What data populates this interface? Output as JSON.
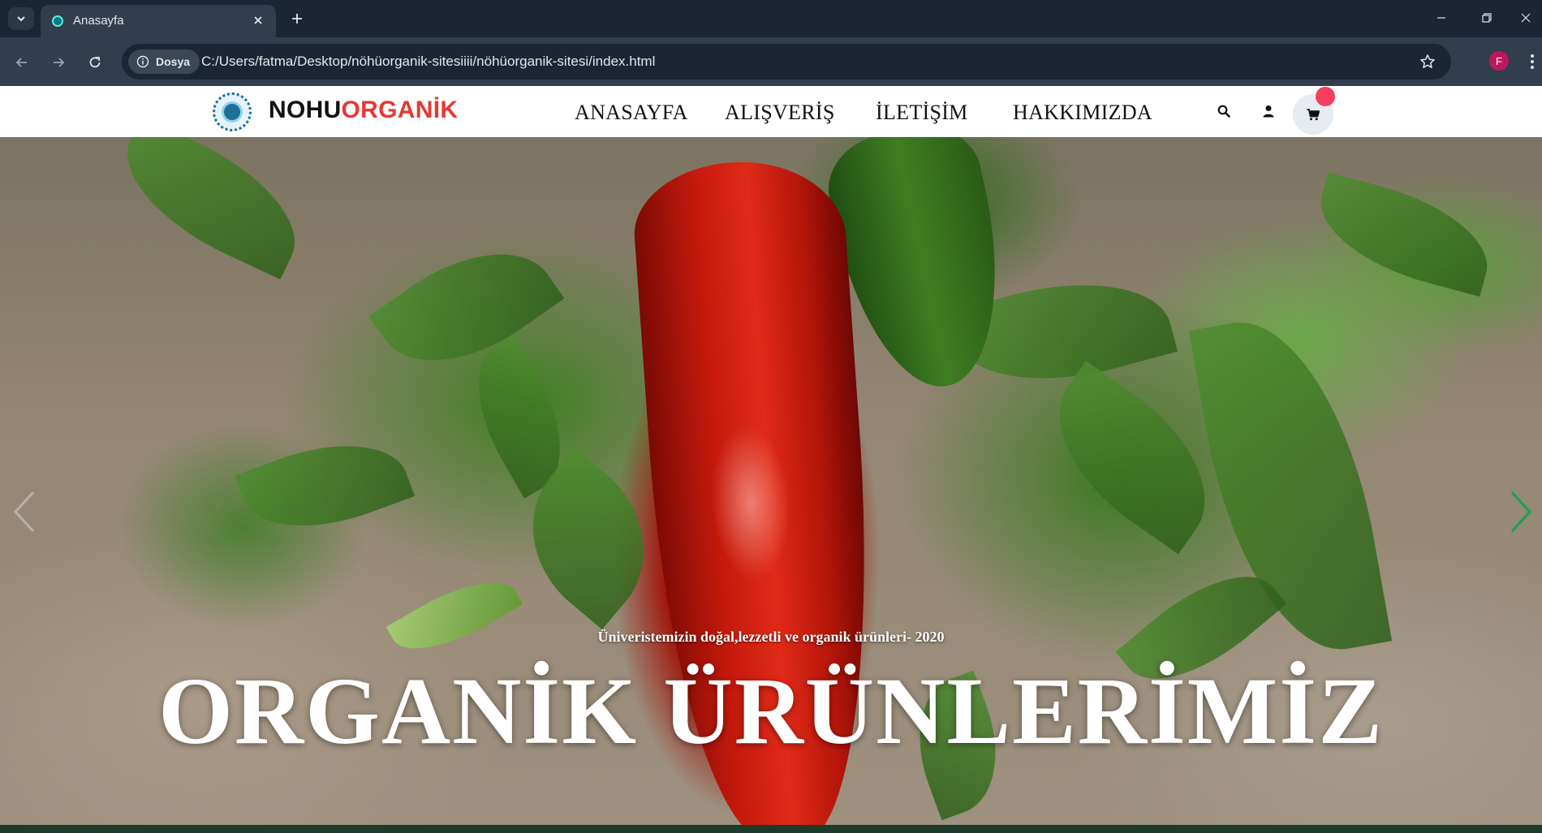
{
  "browser": {
    "tab_title": "Anasayfa",
    "security_chip": "Dosya",
    "url": "C:/Users/fatma/Desktop/nöhüorganik-sitesiiii/nöhüorganik-sitesi/index.html",
    "profile_initial": "F"
  },
  "site": {
    "brand_part1": "NOHU",
    "brand_part2": "ORGANİK",
    "brand_colors": {
      "primary": "#111111",
      "accent": "#e53935"
    },
    "nav": [
      {
        "label": "ANASAYFA"
      },
      {
        "label": "ALIŞVERİŞ"
      },
      {
        "label": "İLETİŞİM"
      },
      {
        "label": "HAKKIMIZDA"
      }
    ],
    "icons": [
      "search-icon",
      "user-icon",
      "cart-icon"
    ],
    "cart_badge_color": "#f43f5e"
  },
  "hero": {
    "subtitle": "Üniveristemizin doğal,lezzetli ve organik ürünleri- 2020",
    "title": "ORGANİK ÜRÜNLERİMİZ",
    "arrow_color": "#16a34a"
  }
}
